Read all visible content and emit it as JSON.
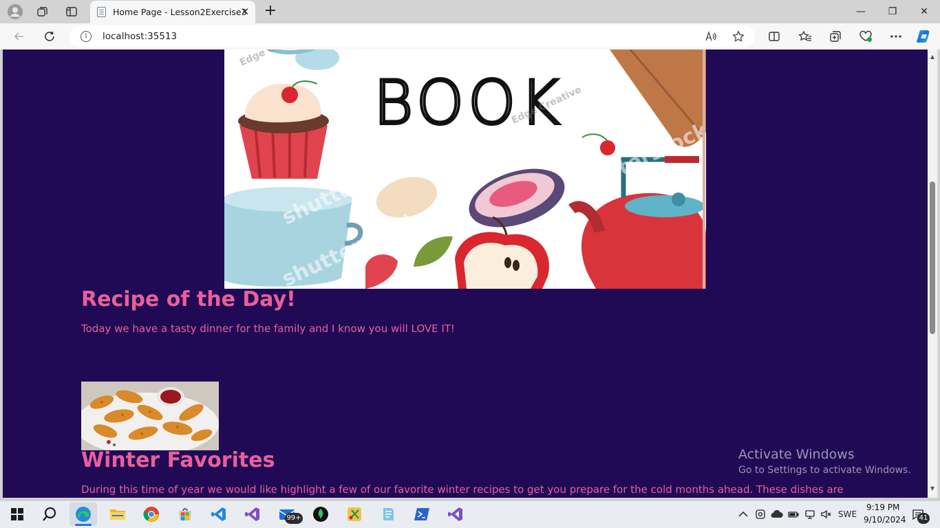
{
  "browser": {
    "tab_title": "Home Page - Lesson2Exercise3",
    "close_tab_glyph": "✕",
    "new_tab_glyph": "+",
    "url": "localhost:35513",
    "window_controls": {
      "minimize": "—",
      "restore": "❐",
      "close": "✕"
    }
  },
  "page": {
    "hero_heading": "BOOK",
    "hero_watermarks": [
      "shutterstock",
      "Edge Creative"
    ],
    "recipe_of_day_title": "Recipe of the Day!",
    "recipe_of_day_text": "Today we have a tasty dinner for the family and I know you will LOVE IT!",
    "winter_title": "Winter Favorites",
    "winter_text": "During this time of year we would like highlight a few of our favorite winter recipes to get you prepare for the cold months ahead. These dishes are",
    "colors": {
      "background": "#200a55",
      "accent_text": "#e8609b"
    }
  },
  "watermark": {
    "title": "Activate Windows",
    "subtitle": "Go to Settings to activate Windows."
  },
  "taskbar": {
    "mail_badge": "99+",
    "language": "SWE",
    "time": "9:19 PM",
    "date": "9/10/2024",
    "notification_count": "41"
  }
}
